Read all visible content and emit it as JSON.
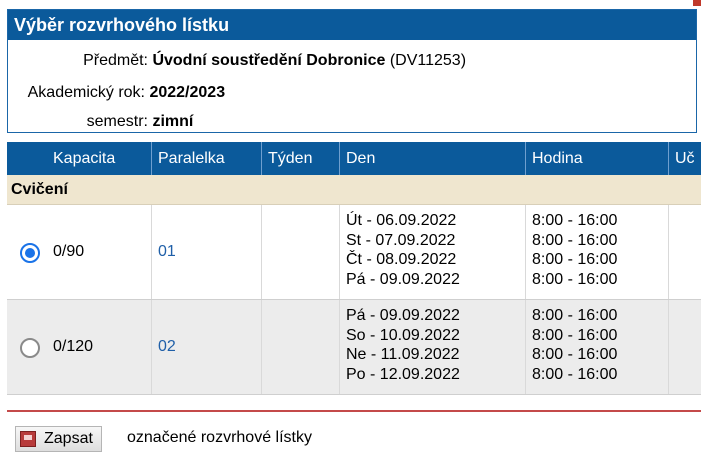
{
  "header": {
    "title": "Výběr rozvrhového lístku"
  },
  "info": {
    "subject_label": "Předmět:",
    "subject_name": "Úvodní soustředění Dobronice",
    "subject_code": "(DV11253)",
    "year_label": "Akademický rok:",
    "year_value": "2022/2023",
    "semester_label": "semestr:",
    "semester_value": "zimní"
  },
  "table": {
    "columns": [
      "Kapacita",
      "Paralelka",
      "Týden",
      "Den",
      "Hodina",
      "Uč"
    ],
    "section": "Cvičení",
    "rows": [
      {
        "selected": true,
        "capacity": "0/90",
        "parallel": "01",
        "week": "",
        "days": [
          "Út - 06.09.2022",
          "St - 07.09.2022",
          "Čt - 08.09.2022",
          "Pá - 09.09.2022"
        ],
        "hours": [
          "8:00 - 16:00",
          "8:00 - 16:00",
          "8:00 - 16:00",
          "8:00 - 16:00"
        ]
      },
      {
        "selected": false,
        "capacity": "0/120",
        "parallel": "02",
        "week": "",
        "days": [
          "Pá - 09.09.2022",
          "So - 10.09.2022",
          "Ne - 11.09.2022",
          "Po - 12.09.2022"
        ],
        "hours": [
          "8:00 - 16:00",
          "8:00 - 16:00",
          "8:00 - 16:00",
          "8:00 - 16:00"
        ]
      }
    ]
  },
  "footer": {
    "button_label": "Zapsat",
    "button_icon": "save-icon",
    "text": "označené rozvrhové lístky"
  },
  "colors": {
    "header_bg": "#0b5a9b",
    "section_bg": "#efe6cf",
    "link": "#1f5fa8",
    "radio": "#1a73e8",
    "footer_rule": "#c44a4a"
  }
}
